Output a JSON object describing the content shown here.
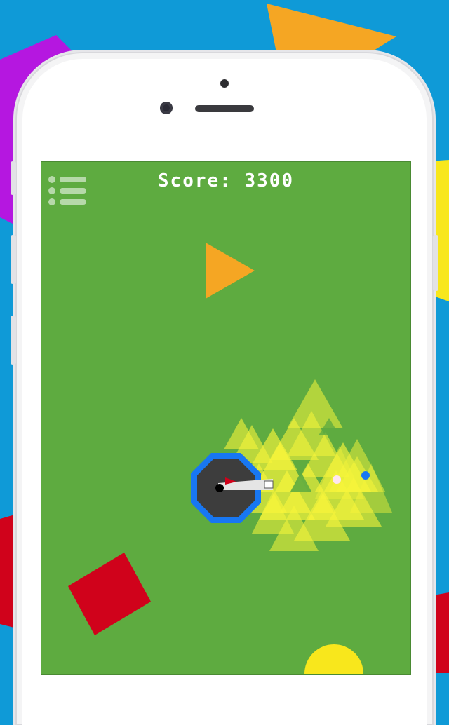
{
  "hud": {
    "score_label": "Score:",
    "score_value": "3300",
    "menu_icon": "menu-list-icon"
  },
  "colors": {
    "background": "#0f9ad7",
    "field": "#5eab40",
    "enemy_triangle": "#f5a623",
    "enemy_square": "#d0021b",
    "enemy_circle": "#f8e71c",
    "player_ring": "#1877f2",
    "player_body": "#3d3d3d",
    "shield_triangles": "#f8f53a"
  },
  "entities": {
    "player": "player-tank",
    "enemies": [
      "orange-triangle-enemy",
      "red-square-enemy",
      "yellow-circle-enemy"
    ],
    "effects": [
      "yellow-triangle-swarm",
      "white-bullet",
      "blue-bullet"
    ]
  }
}
